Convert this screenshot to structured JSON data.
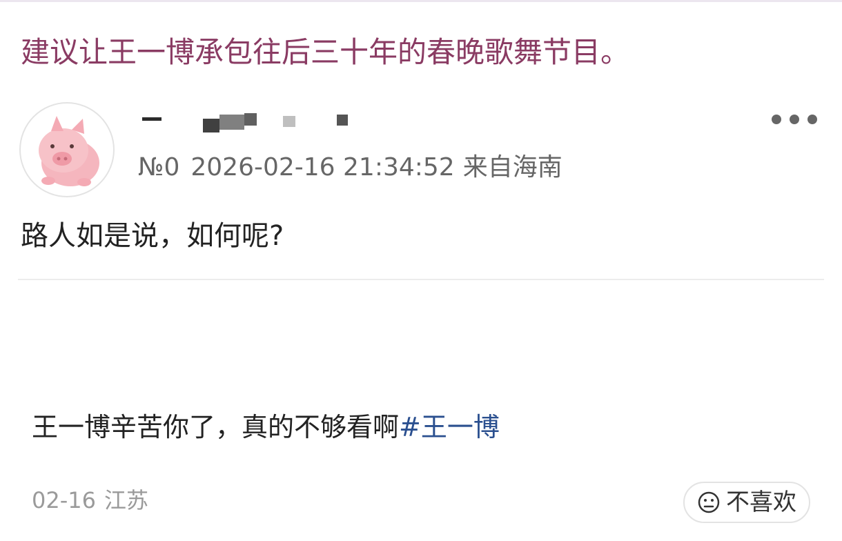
{
  "post": {
    "title": "建议让王一博承包往后三十年的春晚歌舞节目。",
    "author": {
      "floor": "№0",
      "datetime": "2026-02-16 21:34:52",
      "location": "来自海南"
    },
    "body": "路人如是说，如何呢?"
  },
  "comment": {
    "text": "王一博辛苦你了，真的不够看啊",
    "hashtag": "#王一博",
    "date": "02-16",
    "location": "江苏",
    "dislike_label": "不喜欢"
  },
  "colors": {
    "title": "#8a3b63",
    "hashtag": "#2a4f8f",
    "text": "#222222",
    "meta": "#666666",
    "muted": "#9a9a9a"
  },
  "icons": {
    "avatar": "cartoon-pig-avatar",
    "more": "more-dots-icon",
    "dislike": "frown-face-icon"
  }
}
